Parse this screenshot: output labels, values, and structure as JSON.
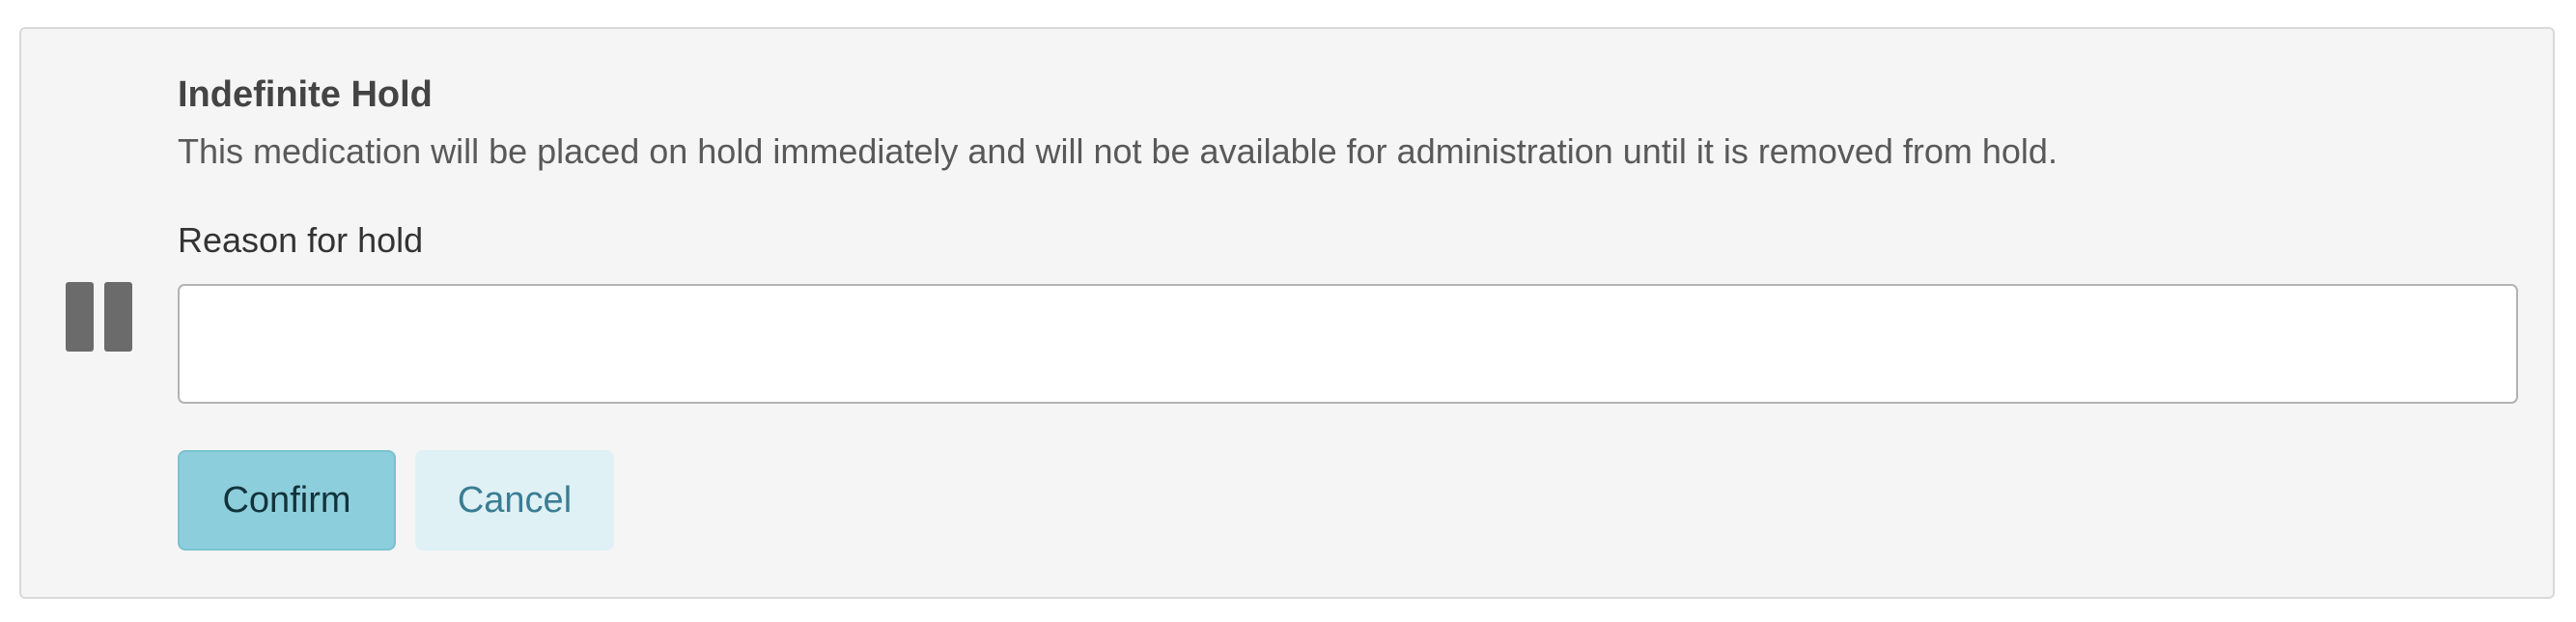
{
  "hold_panel": {
    "icon": "pause-icon",
    "title": "Indefinite Hold",
    "description": "This medication will be placed on hold immediately and will not be available for administration until it is removed from hold.",
    "reason_label": "Reason for hold",
    "reason_value": "",
    "reason_placeholder": "",
    "confirm_label": "Confirm",
    "cancel_label": "Cancel"
  },
  "colors": {
    "panel_background": "#f5f5f5",
    "icon": "#6b6b6b",
    "confirm_background": "#8dcedc",
    "cancel_background": "#dff1f5",
    "cancel_text": "#3a7d93"
  }
}
